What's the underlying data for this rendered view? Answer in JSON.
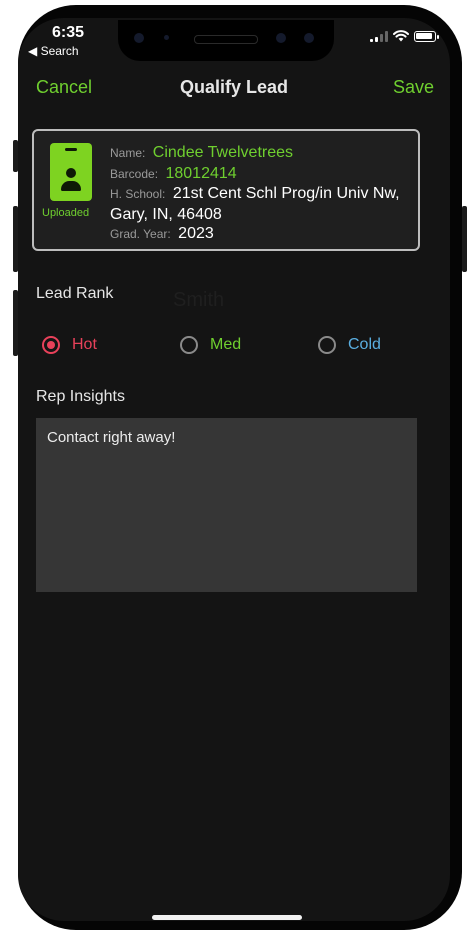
{
  "status_bar": {
    "time": "6:35",
    "back_label": "◀ Search"
  },
  "nav": {
    "cancel_label": "Cancel",
    "title": "Qualify Lead",
    "save_label": "Save"
  },
  "lead": {
    "badge_caption": "Uploaded",
    "name_label": "Name:",
    "name_value": "Cindee Twelvetrees",
    "barcode_label": "Barcode:",
    "barcode_value": "18012414",
    "school_label": "H. School:",
    "school_value": "21st Cent Schl Prog/in Univ Nw, Gary, IN, 46408",
    "grad_label": "Grad. Year:",
    "grad_value": "2023"
  },
  "lead_rank": {
    "title": "Lead Rank",
    "overlay_text": "Smith",
    "options": [
      {
        "label": "Hot",
        "selected": true,
        "color": "#e8415a"
      },
      {
        "label": "Med",
        "selected": false,
        "color": "#6fcf2f"
      },
      {
        "label": "Cold",
        "selected": false,
        "color": "#5aaee0"
      }
    ]
  },
  "insights": {
    "title": "Rep Insights",
    "text": "Contact right away!"
  },
  "colors": {
    "accent": "#6fcf2f",
    "hot": "#e8415a",
    "cold": "#5aaee0",
    "badge": "#7ed321"
  },
  "icons": [
    "back-arrow-icon",
    "signal-icon",
    "wifi-icon",
    "battery-icon",
    "id-badge-icon"
  ]
}
